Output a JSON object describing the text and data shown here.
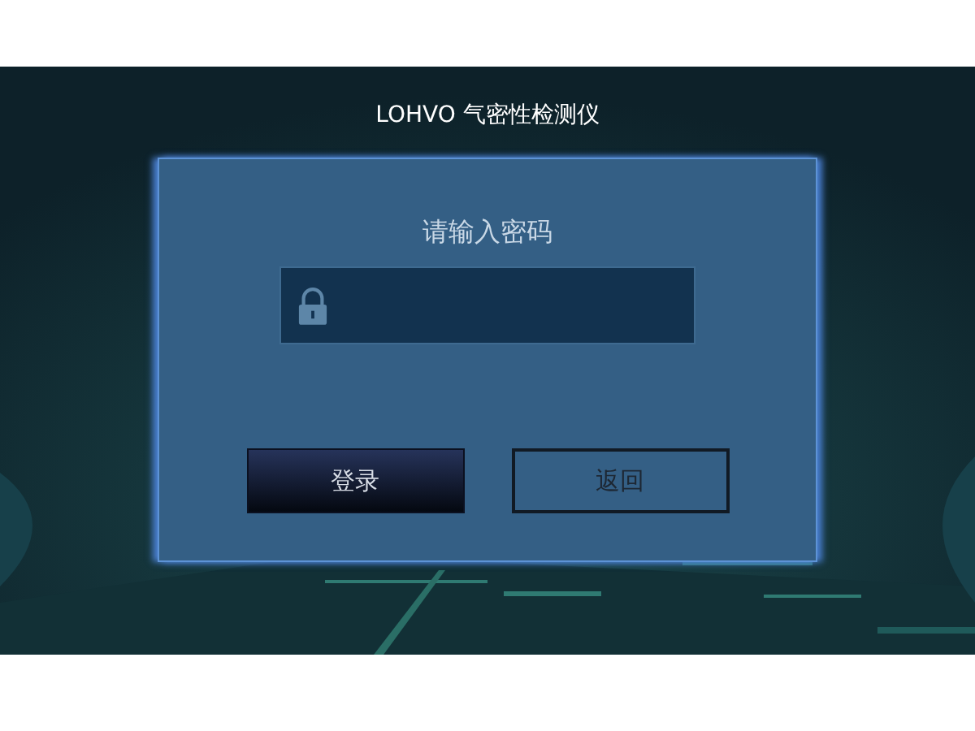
{
  "header": {
    "title": "LOHVO 气密性检测仪"
  },
  "dialog": {
    "prompt": "请输入密码",
    "buttons": [
      {
        "label": "登录",
        "kind": "primary"
      },
      {
        "label": "返回",
        "kind": "outline"
      }
    ]
  }
}
